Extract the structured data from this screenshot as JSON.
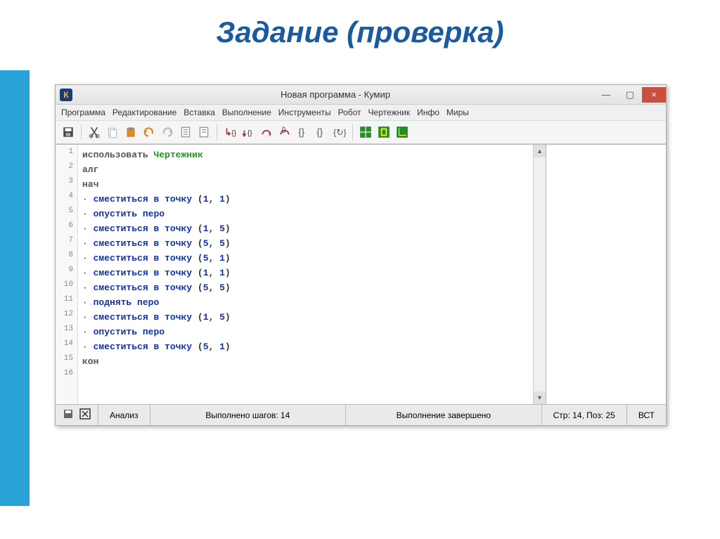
{
  "page_title": "Задание (проверка)",
  "window": {
    "icon_letter": "К",
    "title": "Новая программа - Кумир",
    "controls": {
      "minimize": "—",
      "maximize": "▢",
      "close": "×"
    }
  },
  "menu": [
    "Программа",
    "Редактирование",
    "Вставка",
    "Выполнение",
    "Инструменты",
    "Робот",
    "Чертежник",
    "Инфо",
    "Миры"
  ],
  "code": {
    "lines": [
      {
        "n": 1,
        "type": "use",
        "kw": "использовать",
        "mod": "Чертежник"
      },
      {
        "n": 2,
        "type": "plain",
        "kw": "алг"
      },
      {
        "n": 3,
        "type": "plain",
        "kw": "нач"
      },
      {
        "n": 4,
        "type": "move",
        "cmd": "сместиться в точку",
        "args": [
          1,
          1
        ]
      },
      {
        "n": 5,
        "type": "cmd",
        "cmd": "опустить перо"
      },
      {
        "n": 6,
        "type": "move",
        "cmd": "сместиться в точку",
        "args": [
          1,
          5
        ]
      },
      {
        "n": 7,
        "type": "move",
        "cmd": "сместиться в точку",
        "args": [
          5,
          5
        ]
      },
      {
        "n": 8,
        "type": "move",
        "cmd": "сместиться в точку",
        "args": [
          5,
          1
        ]
      },
      {
        "n": 9,
        "type": "move",
        "cmd": "сместиться в точку",
        "args": [
          1,
          1
        ]
      },
      {
        "n": 10,
        "type": "move",
        "cmd": "сместиться в точку",
        "args": [
          5,
          5
        ]
      },
      {
        "n": 11,
        "type": "cmd",
        "cmd": "поднять перо"
      },
      {
        "n": 12,
        "type": "move",
        "cmd": "сместиться в точку",
        "args": [
          1,
          5
        ]
      },
      {
        "n": 13,
        "type": "cmd",
        "cmd": "опустить перо"
      },
      {
        "n": 14,
        "type": "move",
        "cmd": "сместиться в точку",
        "args": [
          5,
          1
        ]
      },
      {
        "n": 15,
        "type": "plain",
        "kw": "кон"
      },
      {
        "n": 16,
        "type": "empty"
      }
    ]
  },
  "status": {
    "analysis": "Анализ",
    "steps": "Выполнено шагов: 14",
    "state": "Выполнение завершено",
    "pos": "Стр: 14, Поз: 25",
    "mode": "ВСТ"
  }
}
